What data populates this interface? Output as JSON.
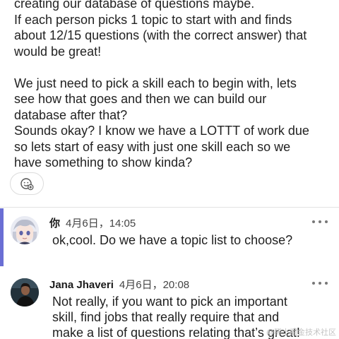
{
  "message_top": {
    "lines": [
      "creating our database of questions maybe.",
      "If each person picks 1 topic to start with and finds",
      "about 12/15 questions (with the correct answer) that",
      "would be great!",
      "",
      "We just need to pick a skill each to begin with, lets",
      "see how that goes and then we can build our",
      "database after that?",
      "Sounds okay? I know we have a LOTTT of work due",
      "so lets start of easy with just one skill each so we",
      "have something to show kinda?"
    ]
  },
  "reaction": {
    "icon": "add-reaction-icon"
  },
  "messages": [
    {
      "author": "你",
      "time": "4月6日，14:05",
      "text": "ok,cool. Do we have a topic list to choose?",
      "highlighted": true
    },
    {
      "author": "Jana Jhaveri",
      "time": "4月6日，20:08",
      "lines": [
        "Not really, if you want to pick an important",
        "skill, find jobs that really require that and",
        "make a list of questions relating that’s great!"
      ]
    }
  ],
  "colors": {
    "highlight": "#6a6ed4"
  },
  "watermark": "@稀土掘金技术社区"
}
